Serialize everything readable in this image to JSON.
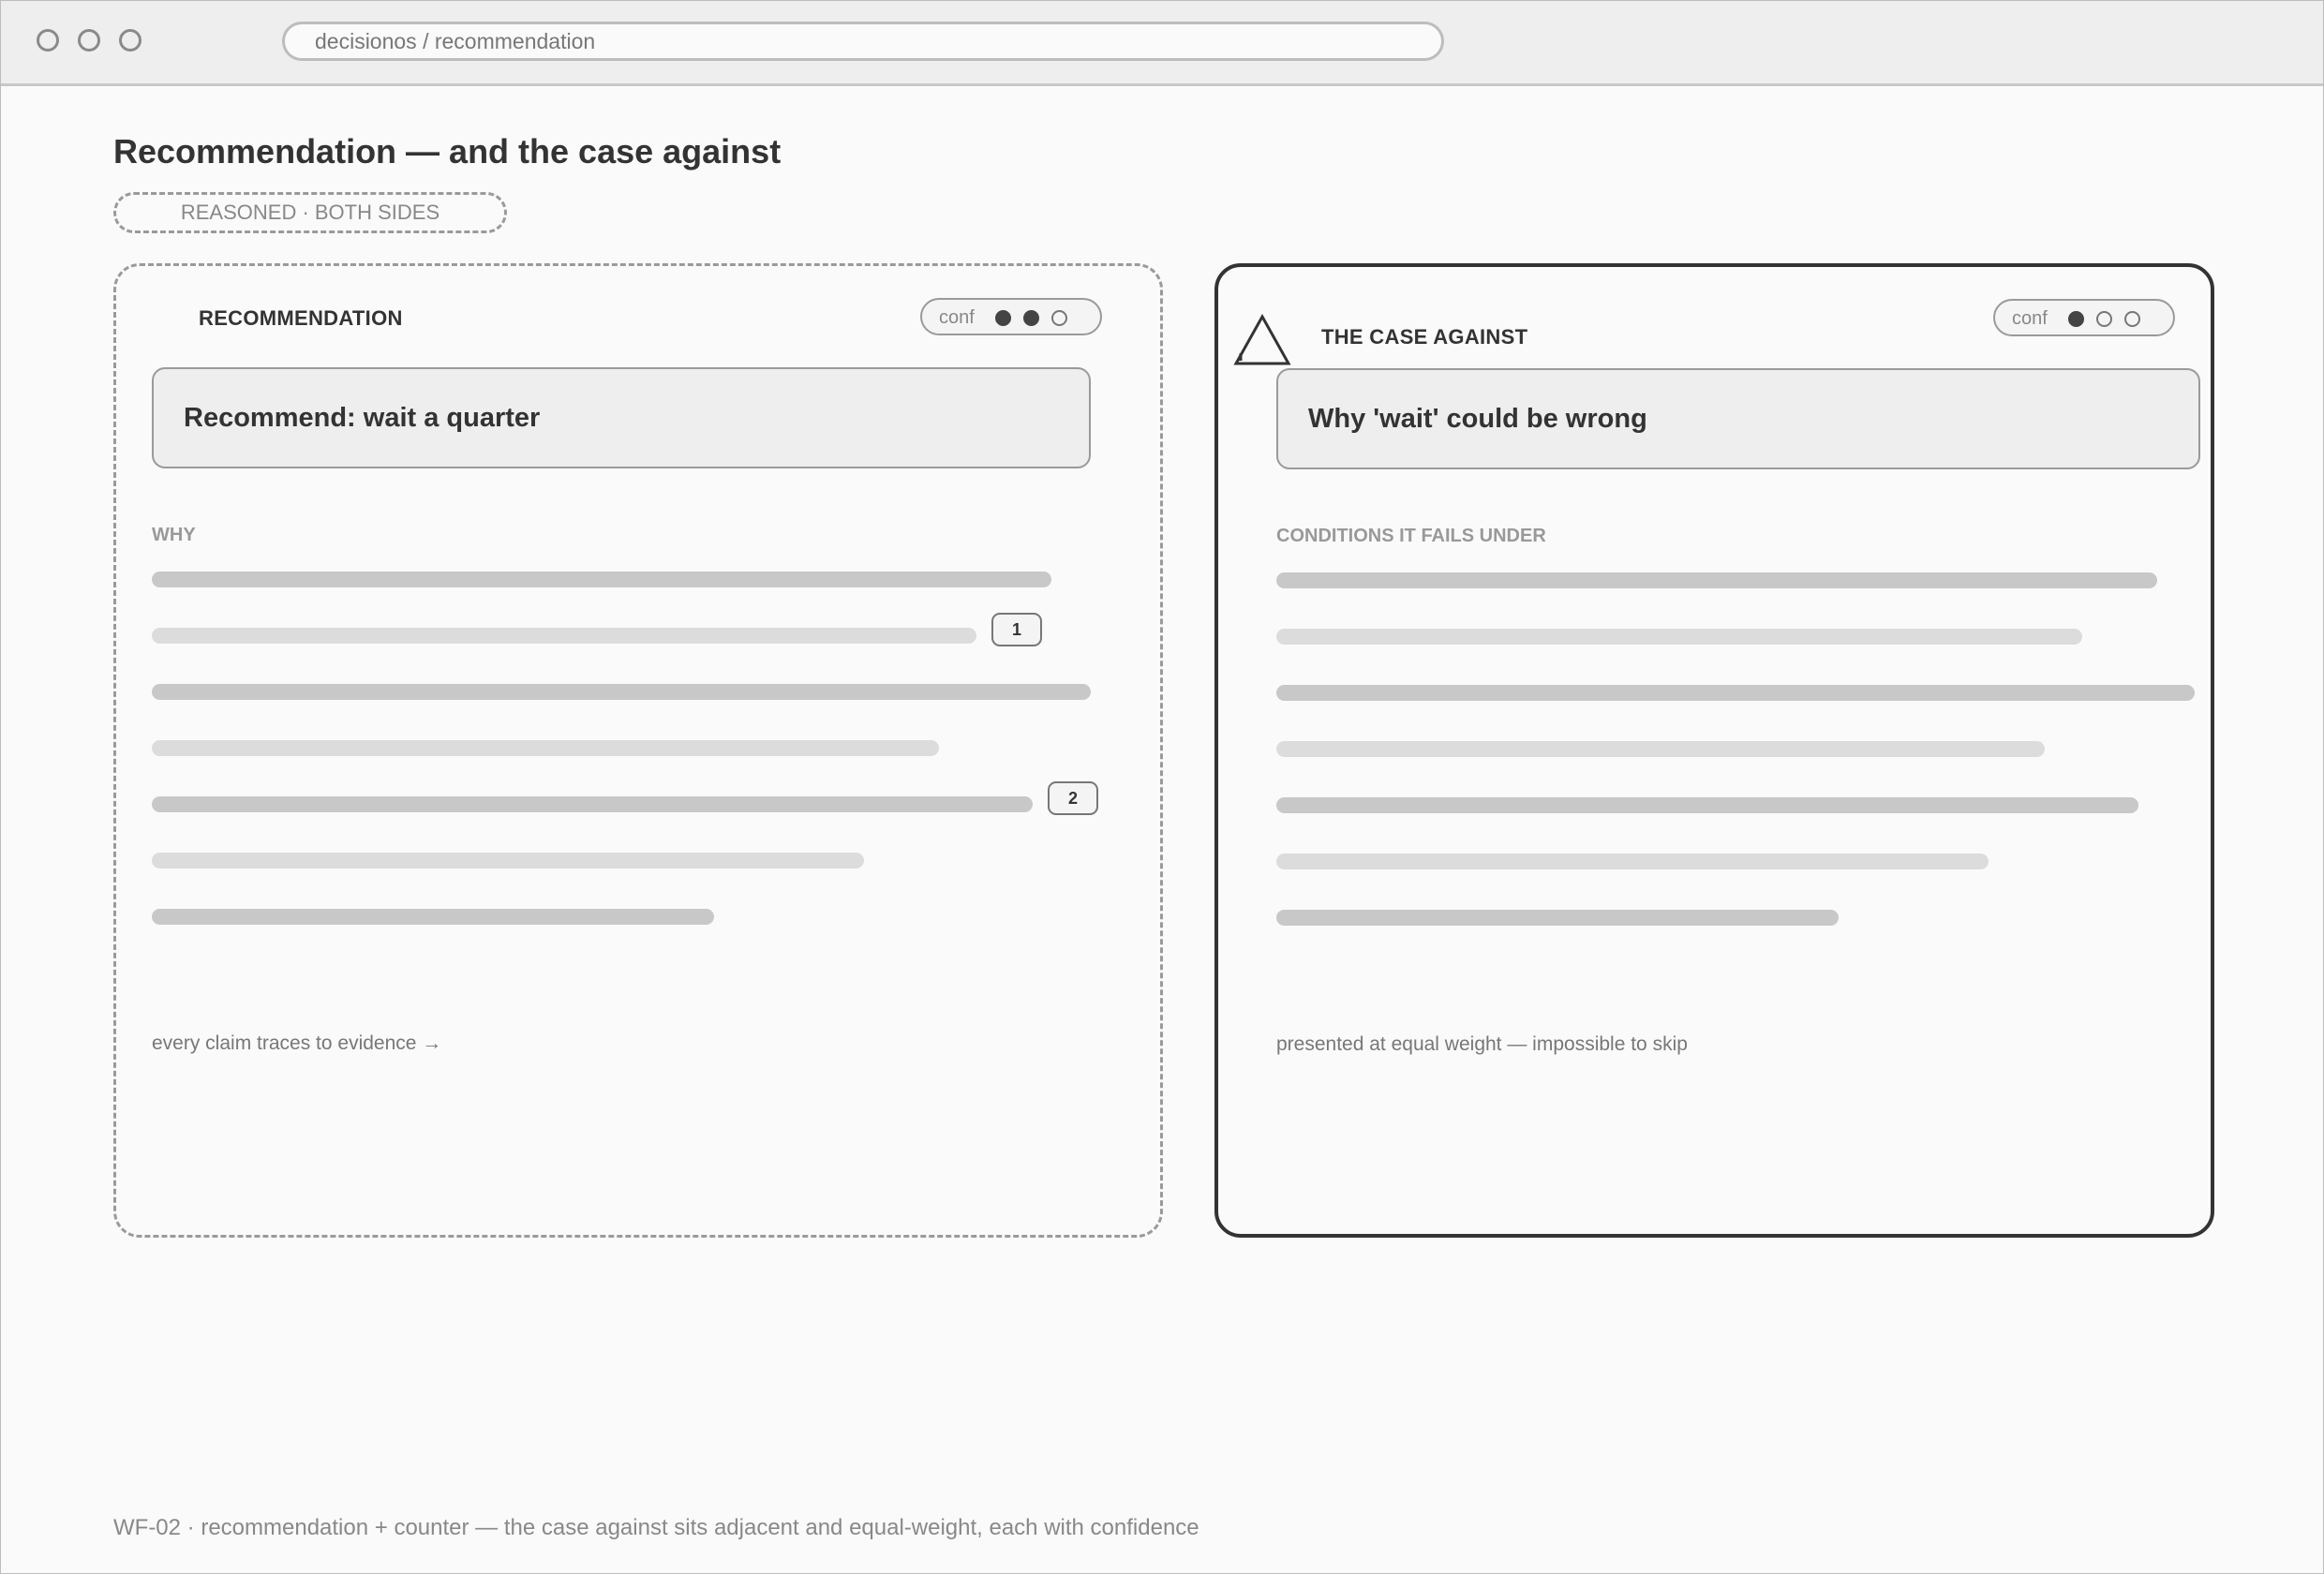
{
  "browser": {
    "url": "decisionos / recommendation"
  },
  "page": {
    "title": "Recommendation — and the case against",
    "tag": "REASONED · BOTH SIDES"
  },
  "recommendation": {
    "label": "RECOMMENDATION",
    "conf_label": "conf",
    "confidence": {
      "filled": 2,
      "total": 3
    },
    "headline": "Recommend: wait a quarter",
    "section": "WHY",
    "badges": [
      "1",
      "2"
    ],
    "footnote": "every claim traces to evidence →"
  },
  "counter": {
    "label": "THE CASE AGAINST",
    "icon": "warning-triangle-icon",
    "conf_label": "conf",
    "confidence": {
      "filled": 1,
      "total": 3
    },
    "headline": "Why 'wait' could be wrong",
    "section": "CONDITIONS IT FAILS UNDER",
    "footnote": "presented at equal weight — impossible to skip"
  },
  "caption": "WF-02 · recommendation + counter — the case against sits adjacent and equal-weight, each with confidence",
  "colors": {
    "border_dashed": "#9a9a9a",
    "border_solid": "#333333",
    "bar_dark": "#c8c8c8",
    "bar_light": "#dcdcdc",
    "background": "#fafafa"
  }
}
